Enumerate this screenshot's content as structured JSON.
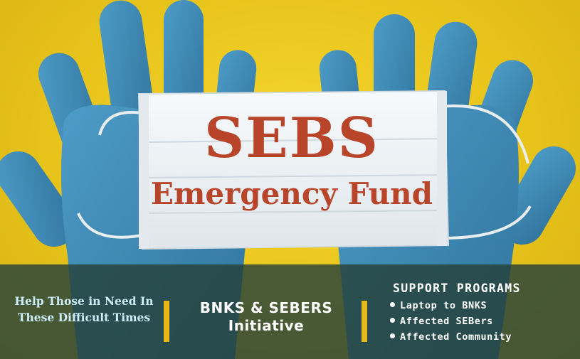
{
  "poster": {
    "title": "SEBS",
    "subtitle": "Emergency Fund"
  },
  "band": {
    "help_text": "Help Those in Need In These Difficult Times",
    "initiative": "BNKS & SEBERS Initiative",
    "programs_heading": "SUPPORT PROGRAMS",
    "programs": [
      "Laptop to BNKS",
      "Affected SEBers",
      "Affected Community"
    ]
  },
  "colors": {
    "background": "#e8c41b",
    "glove": "#3d89b5",
    "mask": "#eef3f6",
    "title": "#b8452a",
    "band": "#26423a",
    "divider": "#e6b818",
    "help_text": "#cdeefb"
  },
  "icons": [
    "left-glove-icon",
    "right-glove-icon",
    "face-mask-icon"
  ]
}
